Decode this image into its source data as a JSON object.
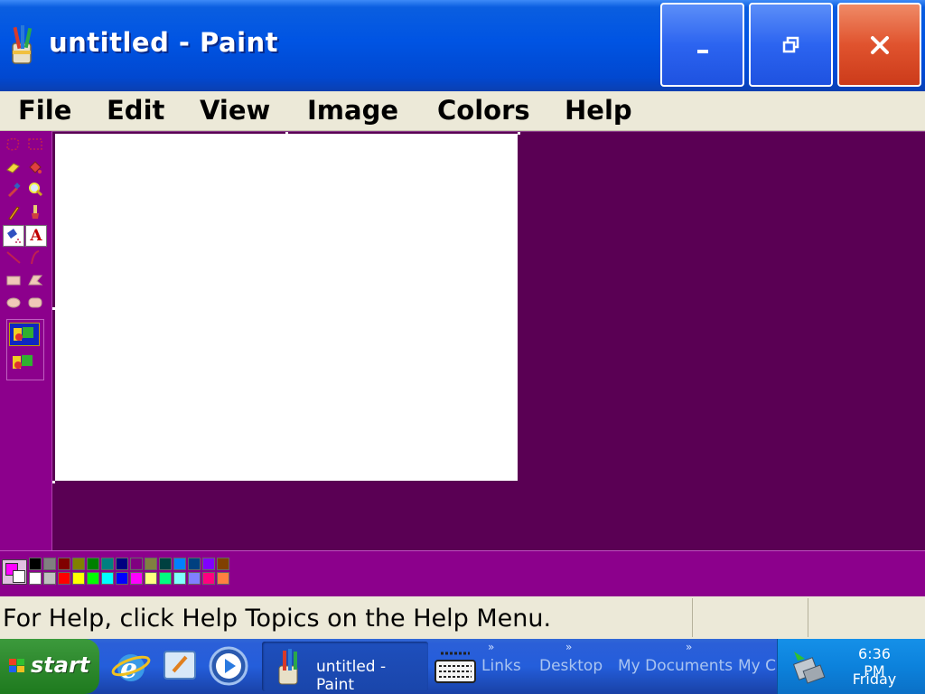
{
  "window": {
    "title": "untitled - Paint",
    "minimize_glyph": "_",
    "restore_glyph": "❐",
    "close_glyph": "✕"
  },
  "menu": [
    "File",
    "Edit",
    "View",
    "Image",
    "Colors",
    "Help"
  ],
  "toolbox": {
    "tools": [
      "free-form-select",
      "select",
      "eraser",
      "fill-with-color",
      "pick-color",
      "magnifier",
      "pencil",
      "brush",
      "airbrush",
      "text",
      "line",
      "curve",
      "rectangle",
      "polygon",
      "ellipse",
      "rounded-rectangle"
    ],
    "selected": "airbrush",
    "text_tool_glyph": "A"
  },
  "palette": {
    "foreground": "#ff00ff",
    "background": "#ffffff",
    "row1": [
      "#000000",
      "#808080",
      "#800000",
      "#808000",
      "#008000",
      "#008080",
      "#000080",
      "#800080",
      "#808040",
      "#004040",
      "#0080ff",
      "#004080",
      "#8000ff",
      "#804000"
    ],
    "row2": [
      "#ffffff",
      "#c0c0c0",
      "#ff0000",
      "#ffff00",
      "#00ff00",
      "#00ffff",
      "#0000ff",
      "#ff00ff",
      "#ffff80",
      "#00ff80",
      "#80ffff",
      "#8080ff",
      "#ff0080",
      "#ff8040"
    ]
  },
  "status": {
    "help_text": "For Help, click Help Topics on the Help Menu."
  },
  "taskbar": {
    "start_label": "start",
    "active_task": "untitled - Paint",
    "toolbar_links": [
      "Links",
      "Desktop",
      "My Documents",
      "My C"
    ],
    "clock_time": "6:36 PM",
    "clock_day": "Friday"
  }
}
